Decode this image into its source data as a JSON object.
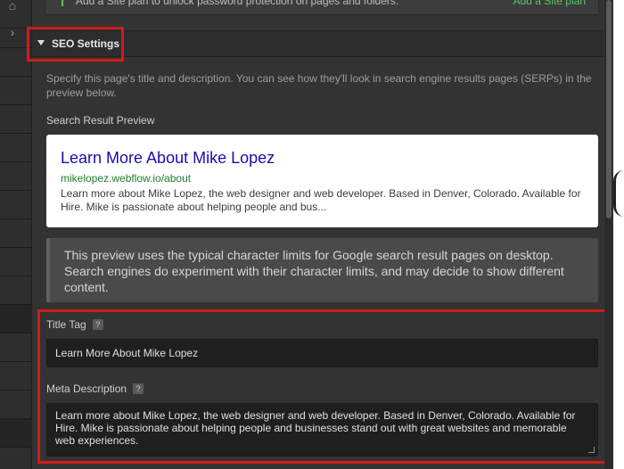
{
  "top_banner": {
    "message": "Add a Site plan to unlock password protection on pages and folders.",
    "link": "Add a Site plan"
  },
  "seo": {
    "section_title": "SEO Settings",
    "description": "Specify this page's title and description. You can see how they'll look in search engine results pages (SERPs) in the preview below.",
    "preview_label": "Search Result Preview",
    "preview": {
      "title": "Learn More About Mike Lopez",
      "url": "mikelopez.webflow.io/about",
      "description": "Learn more about Mike Lopez, the web designer and web developer. Based in Denver, Colorado. Available for Hire. Mike is passionate about helping people and bus..."
    },
    "note": "This preview uses the typical character limits for Google search result pages on desktop. Search engines do experiment with their character limits, and may decide to show different content.",
    "title_tag_label": "Title Tag",
    "title_tag_value": "Learn More About Mike Lopez",
    "meta_description_label": "Meta Description",
    "meta_description_value": "Learn more about Mike Lopez, the web designer and web developer. Based in Denver, Colorado. Available for Hire. Mike is passionate about helping people and businesses stand out with great websites and memorable web experiences.",
    "help_glyph": "?"
  },
  "rail": {
    "home_icon": "⌂",
    "expand_icon": "›"
  },
  "colors": {
    "highlight": "#d11b1b",
    "link_green": "#5cc46d",
    "serp_title": "#1a0dab",
    "serp_url": "#1e7d2e"
  }
}
